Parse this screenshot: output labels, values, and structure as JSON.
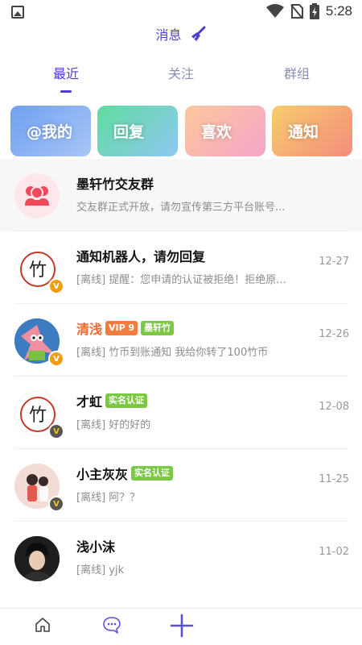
{
  "status_bar": {
    "time": "5:28"
  },
  "header": {
    "title": "消息"
  },
  "tabs": [
    {
      "label": "最近",
      "active": true
    },
    {
      "label": "关注",
      "active": false
    },
    {
      "label": "群组",
      "active": false
    }
  ],
  "cards": [
    {
      "label": "@我的"
    },
    {
      "label": "回复"
    },
    {
      "label": "喜欢"
    },
    {
      "label": "通知"
    }
  ],
  "messages": [
    {
      "name": "墨轩竹交友群",
      "preview": "交友群正式开放，请勿宣传第三方平台账号...",
      "date": ""
    },
    {
      "name": "通知机器人，请勿回复",
      "preview": "[离线] 提醒：您申请的认证被拒绝！拒绝原...",
      "date": "12-27"
    },
    {
      "name": "清浅",
      "badges": [
        "VIP 9",
        "墨轩竹"
      ],
      "preview": "[离线] 竹币到账通知 我给你转了100竹币",
      "date": "12-26"
    },
    {
      "name": "才虹",
      "badges": [
        "实名认证"
      ],
      "preview": "[离线] 好的好的",
      "date": "12-08"
    },
    {
      "name": "小主灰灰",
      "badges": [
        "实名认证"
      ],
      "preview": "[离线] 阿？？",
      "date": "11-25"
    },
    {
      "name": "浅小沫",
      "preview": "[离线] yjk",
      "date": "11-02"
    }
  ],
  "bottom_nav": [
    {
      "icon": "home-icon"
    },
    {
      "icon": "message-icon"
    },
    {
      "icon": "plus-icon"
    }
  ]
}
